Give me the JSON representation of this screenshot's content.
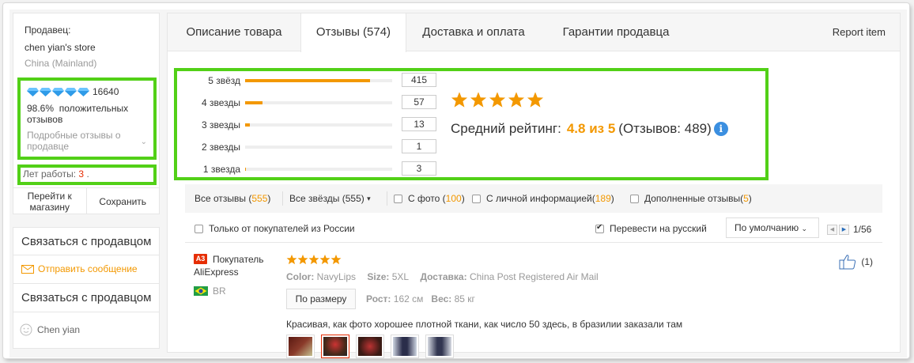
{
  "seller": {
    "label": "Продавец:",
    "name": "chen yian's store",
    "country": "China (Mainland)",
    "score": "16640",
    "positive_pct": "98.6%",
    "positive_label": "положительных отзывов",
    "detailed_link": "Подробные отзывы о продавце",
    "years_label": "Лет работы:",
    "years_value": "3",
    "years_suffix": ".",
    "go_to_store": "Перейти к магазину",
    "save": "Сохранить"
  },
  "contact": {
    "title1": "Связаться с продавцом",
    "send_message": "Отправить сообщение",
    "title2": "Связаться с продавцом",
    "person": "Chen yian"
  },
  "tabs": {
    "description": "Описание товара",
    "reviews": "Отзывы (574)",
    "delivery": "Доставка и оплата",
    "guarantees": "Гарантии продавца",
    "report": "Report item"
  },
  "rating_breakdown": {
    "rows": [
      {
        "label": "5 звёзд",
        "count": "415",
        "fraction": 0.85
      },
      {
        "label": "4 звезды",
        "count": "57",
        "fraction": 0.12
      },
      {
        "label": "3 звезды",
        "count": "13",
        "fraction": 0.03
      },
      {
        "label": "2 звезды",
        "count": "1",
        "fraction": 0.0
      },
      {
        "label": "1 звезда",
        "count": "3",
        "fraction": 0.006
      }
    ],
    "avg_label": "Средний рейтинг:",
    "avg_value": "4.8 из 5",
    "total": "(Отзывов: 489)",
    "star_color": "#f39800"
  },
  "filters": {
    "all_reviews": "Все отзывы (",
    "all_reviews_count": "555",
    "all_reviews_close": ")",
    "all_stars": "Все звёзды (555)",
    "with_photo": "С фото (",
    "with_photo_count": "100",
    "with_photo_close": ")",
    "with_personal": "С личной информацией(",
    "with_personal_count": "189",
    "with_personal_close": ")",
    "supplemented": "Дополненные отзывы(",
    "supplemented_count": "5",
    "supplemented_close": ")",
    "russia_only": "Только от покупателей из России",
    "translate": "Перевести на русский",
    "sort": "По умолчанию",
    "page": "1/56"
  },
  "review": {
    "badge": "A3",
    "buyer": "Покупатель AliExpress",
    "country": "BR",
    "color_label": "Color:",
    "color_value": "NavyLips",
    "size_label": "Size:",
    "size_value": "5XL",
    "delivery_label": "Доставка:",
    "delivery_value": "China Post Registered Air Mail",
    "fit": "По размеру",
    "height_label": "Рост:",
    "height_value": "162 см",
    "weight_label": "Вес:",
    "weight_value": "85 кг",
    "text": "Красивая, как фото хорошее плотной ткани, как число 50 здесь, в бразилии заказали там",
    "likes": "(1)",
    "stars": 5
  }
}
